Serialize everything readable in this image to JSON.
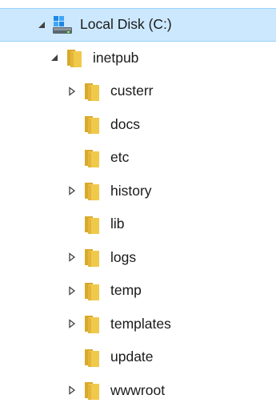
{
  "tree": {
    "root": {
      "label": "Local Disk (C:)",
      "icon": "drive-icon",
      "expanded": true,
      "selected": true
    },
    "folder": {
      "label": "inetpub",
      "icon": "folder-icon",
      "expanded": true
    },
    "children": [
      {
        "label": "custerr",
        "has_children": true
      },
      {
        "label": "docs",
        "has_children": false
      },
      {
        "label": "etc",
        "has_children": false
      },
      {
        "label": "history",
        "has_children": true
      },
      {
        "label": "lib",
        "has_children": false
      },
      {
        "label": "logs",
        "has_children": true
      },
      {
        "label": "temp",
        "has_children": true
      },
      {
        "label": "templates",
        "has_children": true
      },
      {
        "label": "update",
        "has_children": false
      },
      {
        "label": "wwwroot",
        "has_children": true
      }
    ]
  },
  "colors": {
    "selection_bg": "#cce8ff",
    "selection_border": "#99d1ff",
    "folder_front": "#f0c94a",
    "folder_back": "#d9a92b",
    "drive_blue": "#1e88e5"
  }
}
